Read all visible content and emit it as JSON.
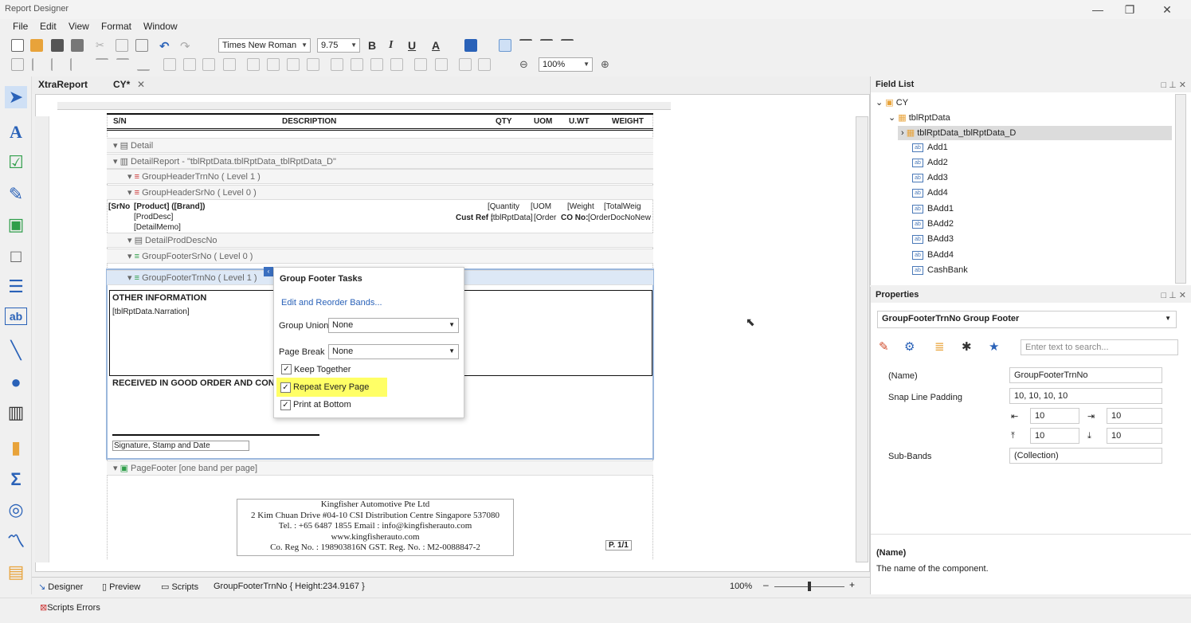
{
  "window": {
    "title": "Report Designer",
    "minimize": "—",
    "maximize": "❐",
    "close": "✕"
  },
  "menu": [
    "File",
    "Edit",
    "View",
    "Format",
    "Window"
  ],
  "toolbar": {
    "font": "Times New Roman",
    "size": "9.75",
    "zoom": "100%",
    "bold": "B",
    "italic": "I",
    "underline": "U",
    "font_color": "A"
  },
  "tabs": [
    {
      "label": "XtraReport"
    },
    {
      "label": "CY*",
      "close": "✕"
    }
  ],
  "report": {
    "header_cols": [
      "S/N",
      "DESCRIPTION",
      "QTY",
      "UOM",
      "U.WT",
      "WEIGHT"
    ],
    "bands": {
      "detail": "Detail",
      "detail_report": "DetailReport - \"tblRptData.tblRptData_tblRptData_D\"",
      "gh_trn": "GroupHeaderTrnNo ( Level 1 )",
      "gh_sr": "GroupHeaderSrNo ( Level 0 )",
      "detail_prod": "DetailProdDescNo",
      "gf_sr": "GroupFooterSrNo ( Level 0 )",
      "gf_trn": "GroupFooterTrnNo ( Level 1 )",
      "page_footer": "PageFooter [one band per page]"
    },
    "fields": {
      "srno": "[SrNo",
      "product": "[Product] ([Brand])",
      "proddesc": "[ProdDesc]",
      "detailmemo": "[DetailMemo]",
      "quantity": "[Quantity",
      "uom": "[UOM",
      "weight": "[Weight",
      "totalweight": "[TotalWeig",
      "custref_label": "Cust Ref :",
      "custref": "[tblRptData]",
      "order": "[Order",
      "cono_label": "CO No:",
      "orderdoc": "[OrderDocNoNew"
    },
    "other_info": "OTHER INFORMATION",
    "narration": "[tblRptData.Narration]",
    "received": "RECEIVED IN GOOD ORDER AND CONDITION",
    "signature": "Signature, Stamp and Date",
    "company": {
      "name": "Kingfisher Automotive Pte Ltd",
      "address": "2 Kim Chuan Drive #04-10 CSI Distribution Centre Singapore 537080",
      "tel": "Tel. : +65 6487 1855    Email : info@kingfisherauto.com",
      "web": "www.kingfisherauto.com",
      "reg": "Co. Reg No. : 198903816N    GST. Reg. No. : M2-0088847-2"
    },
    "page_num": "P. 1/1"
  },
  "popup": {
    "title": "Group Footer Tasks",
    "link": "Edit and Reorder Bands...",
    "group_union_label": "Group Union",
    "group_union": "None",
    "page_break_label": "Page Break",
    "page_break": "None",
    "keep_together": "Keep Together",
    "repeat": "Repeat Every Page",
    "print_bottom": "Print at Bottom"
  },
  "field_list": {
    "title": "Field List",
    "root": "CY",
    "table": "tblRptData",
    "relation": "tblRptData_tblRptData_D",
    "items": [
      "Add1",
      "Add2",
      "Add3",
      "Add4",
      "BAdd1",
      "BAdd2",
      "BAdd3",
      "BAdd4",
      "CashBank"
    ]
  },
  "properties": {
    "title": "Properties",
    "selector": "GroupFooterTrnNo  Group Footer",
    "search_placeholder": "Enter text to search...",
    "rows": [
      {
        "label": "(Name)",
        "value": "GroupFooterTrnNo"
      },
      {
        "label": "Snap Line Padding",
        "value": "10, 10, 10, 10"
      },
      {
        "label": "Sub-Bands",
        "value": "(Collection)"
      }
    ],
    "pad": [
      "10",
      "10",
      "10",
      "10"
    ],
    "desc_title": "(Name)",
    "desc_text": "The name of the component."
  },
  "status": {
    "designer": "Designer",
    "preview": "Preview",
    "scripts": "Scripts",
    "info": "GroupFooterTrnNo { Height:234.9167 }",
    "zoom": "100%"
  },
  "bottom": {
    "errors": "Scripts Errors"
  }
}
